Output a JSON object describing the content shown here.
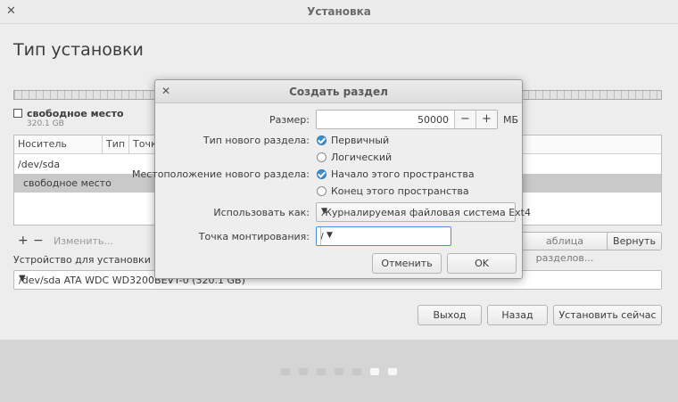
{
  "window": {
    "title": "Установка"
  },
  "page": {
    "title": "Тип установки"
  },
  "legend": {
    "name": "свободное место",
    "size": "320.1 GB"
  },
  "table": {
    "columns": [
      "Носитель",
      "Тип",
      "Точк"
    ],
    "rows": [
      {
        "device": "/dev/sda"
      },
      {
        "device": "свободное место"
      }
    ]
  },
  "toolbar": {
    "add": "+",
    "remove": "−",
    "change": "Изменить...",
    "new_table": "аблица разделов...",
    "revert": "Вернуть"
  },
  "bootloader": {
    "label": "Устройство для установки систе",
    "value": "/dev/sda    ATA WDC WD3200BEVT-0 (320.1 GB)"
  },
  "nav": {
    "quit": "Выход",
    "back": "Назад",
    "install": "Установить сейчас"
  },
  "progress": {
    "total_steps": 7,
    "current_step": 6
  },
  "dialog": {
    "title": "Создать раздел",
    "size_label": "Размер:",
    "size_value": "50000",
    "size_unit": "МБ",
    "type_label": "Тип нового раздела:",
    "type_primary": "Первичный",
    "type_logical": "Логический",
    "location_label": "Местоположение нового раздела:",
    "location_start": "Начало этого пространства",
    "location_end": "Конец этого пространства",
    "use_as_label": "Использовать как:",
    "use_as_value": "Журналируемая файловая система Ext4",
    "mount_label": "Точка монтирования:",
    "mount_value": "/",
    "cancel": "Отменить",
    "ok": "OK"
  }
}
